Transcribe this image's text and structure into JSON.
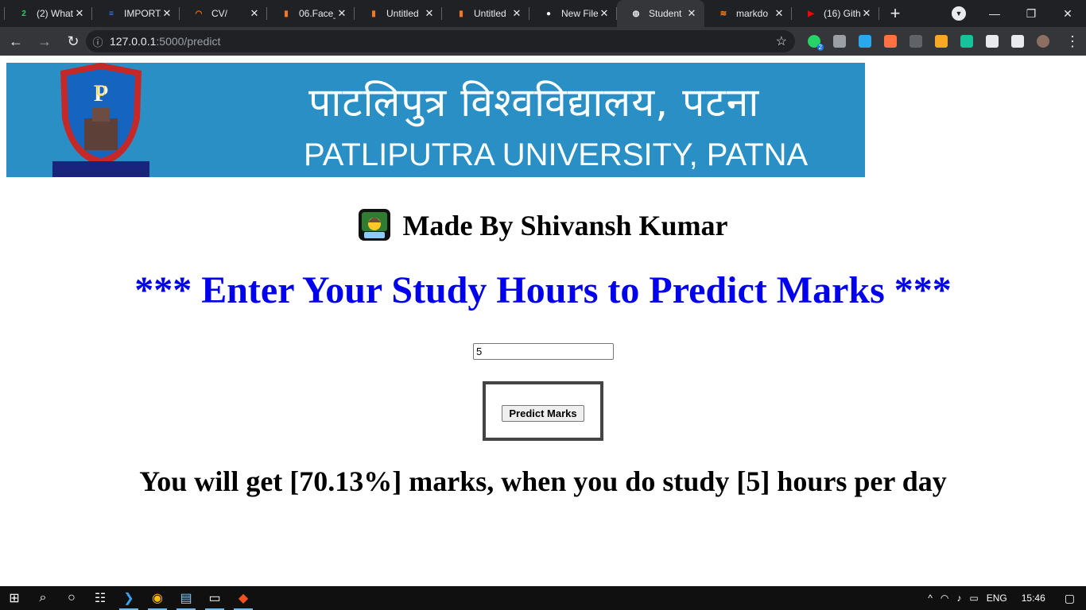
{
  "browser": {
    "tabs": [
      {
        "title": "(2) What",
        "favicon": "whatsapp-icon",
        "color": "#25d366",
        "glyph": "2"
      },
      {
        "title": "IMPORTA",
        "favicon": "google-docs-icon",
        "color": "#4285f4",
        "glyph": "≡"
      },
      {
        "title": "CV/",
        "favicon": "loader-icon",
        "color": "#f57c00",
        "glyph": "◠"
      },
      {
        "title": "06.Face_",
        "favicon": "jupyter-notebook-icon",
        "color": "#f37626",
        "glyph": "▮"
      },
      {
        "title": "Untitled",
        "favicon": "jupyter-notebook-icon",
        "color": "#f37626",
        "glyph": "▮"
      },
      {
        "title": "Untitled",
        "favicon": "jupyter-notebook-icon",
        "color": "#f37626",
        "glyph": "▮"
      },
      {
        "title": "New File",
        "favicon": "github-icon",
        "color": "#ffffff",
        "glyph": "●"
      },
      {
        "title": "Student",
        "favicon": "globe-icon",
        "color": "#e8eaed",
        "glyph": "◍"
      },
      {
        "title": "markdo",
        "favicon": "stackoverflow-icon",
        "color": "#f48024",
        "glyph": "≋"
      },
      {
        "title": "(16) Gith",
        "favicon": "youtube-icon",
        "color": "#ff0000",
        "glyph": "▶"
      }
    ],
    "active_tab_index": 7,
    "address": {
      "host": "127.0.0.1",
      "path": ":5000/predict"
    },
    "extensions": [
      {
        "name": "whatsapp-extension-icon",
        "color": "#25d366",
        "badge": "2"
      },
      {
        "name": "shield-extension-icon",
        "color": "#9aa0a6",
        "badge": ""
      },
      {
        "name": "telegram-extension-icon",
        "color": "#29a9eb",
        "badge": ""
      },
      {
        "name": "tool-extension-icon",
        "color": "#ff7043",
        "badge": ""
      },
      {
        "name": "copy-extension-icon",
        "color": "#5f6368",
        "badge": ""
      },
      {
        "name": "glasses-extension-icon",
        "color": "#f9a825",
        "badge": ""
      },
      {
        "name": "grammarly-extension-icon",
        "color": "#15c39a",
        "badge": ""
      },
      {
        "name": "puzzle-extensions-icon",
        "color": "#e8eaed",
        "badge": ""
      },
      {
        "name": "media-queue-icon",
        "color": "#e8eaed",
        "badge": ""
      },
      {
        "name": "profile-avatar-icon",
        "color": "#8d6e63",
        "badge": ""
      }
    ]
  },
  "banner": {
    "hindi_text": "पाटलिपुत्र विश्वविद्यालय, पटना",
    "english_text": "PATLIPUTRA UNIVERSITY, PATNA",
    "crest_lettering": "पाटलिपुत्र विश्वविद्यालय",
    "background_color": "#2a8fc4"
  },
  "page": {
    "maker_text": "Made By Shivansh Kumar",
    "heading": "*** Enter Your Study Hours to Predict Marks ***",
    "hours_value": "5",
    "button_label": "Predict Marks",
    "result_text": "You will get [70.13%] marks, when you do study [5] hours per day",
    "heading_color": "#0000ee"
  },
  "taskbar": {
    "language": "ENG",
    "time": "15:46"
  }
}
